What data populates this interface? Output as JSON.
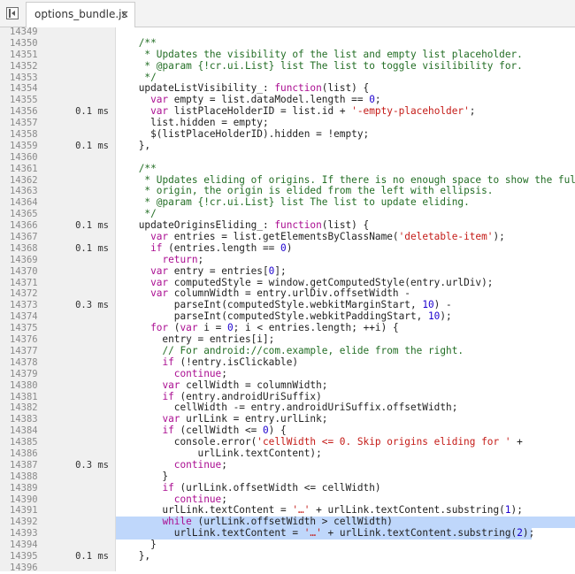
{
  "tab": {
    "filename": "options_bundle.js",
    "close_glyph": "×"
  },
  "lines": [
    {
      "num": "14349",
      "time": "",
      "segs": []
    },
    {
      "num": "14350",
      "time": "",
      "segs": [
        {
          "t": "    "
        },
        {
          "t": "/**",
          "c": "c"
        }
      ]
    },
    {
      "num": "14351",
      "time": "",
      "segs": [
        {
          "t": "     "
        },
        {
          "t": "* Updates the visibility of the list and empty list placeholder.",
          "c": "c"
        }
      ]
    },
    {
      "num": "14352",
      "time": "",
      "segs": [
        {
          "t": "     "
        },
        {
          "t": "* @param {!cr.ui.List} list The list to toggle visilibility for.",
          "c": "c"
        }
      ]
    },
    {
      "num": "14353",
      "time": "",
      "segs": [
        {
          "t": "     "
        },
        {
          "t": "*/",
          "c": "c"
        }
      ]
    },
    {
      "num": "14354",
      "time": "",
      "segs": [
        {
          "t": "    updateListVisibility_: "
        },
        {
          "t": "function",
          "c": "k"
        },
        {
          "t": "(list) {"
        }
      ]
    },
    {
      "num": "14355",
      "time": "",
      "segs": [
        {
          "t": "      "
        },
        {
          "t": "var",
          "c": "k"
        },
        {
          "t": " empty = list.dataModel.length == "
        },
        {
          "t": "0",
          "c": "n"
        },
        {
          "t": ";"
        }
      ]
    },
    {
      "num": "14356",
      "time": "0.1 ms",
      "segs": [
        {
          "t": "      "
        },
        {
          "t": "var",
          "c": "k"
        },
        {
          "t": " listPlaceHolderID = list.id + "
        },
        {
          "t": "'-empty-placeholder'",
          "c": "s"
        },
        {
          "t": ";"
        }
      ]
    },
    {
      "num": "14357",
      "time": "",
      "segs": [
        {
          "t": "      list.hidden = empty;"
        }
      ]
    },
    {
      "num": "14358",
      "time": "",
      "segs": [
        {
          "t": "      $(listPlaceHolderID).hidden = !empty;"
        }
      ]
    },
    {
      "num": "14359",
      "time": "0.1 ms",
      "segs": [
        {
          "t": "    },"
        }
      ]
    },
    {
      "num": "14360",
      "time": "",
      "segs": []
    },
    {
      "num": "14361",
      "time": "",
      "segs": [
        {
          "t": "    "
        },
        {
          "t": "/**",
          "c": "c"
        }
      ]
    },
    {
      "num": "14362",
      "time": "",
      "segs": [
        {
          "t": "     "
        },
        {
          "t": "* Updates eliding of origins. If there is no enough space to show the full",
          "c": "c"
        }
      ]
    },
    {
      "num": "14363",
      "time": "",
      "segs": [
        {
          "t": "     "
        },
        {
          "t": "* origin, the origin is elided from the left with ellipsis.",
          "c": "c"
        }
      ]
    },
    {
      "num": "14364",
      "time": "",
      "segs": [
        {
          "t": "     "
        },
        {
          "t": "* @param {!cr.ui.List} list The list to update eliding.",
          "c": "c"
        }
      ]
    },
    {
      "num": "14365",
      "time": "",
      "segs": [
        {
          "t": "     "
        },
        {
          "t": "*/",
          "c": "c"
        }
      ]
    },
    {
      "num": "14366",
      "time": "0.1 ms",
      "segs": [
        {
          "t": "    updateOriginsEliding_: "
        },
        {
          "t": "function",
          "c": "k"
        },
        {
          "t": "(list) {"
        }
      ]
    },
    {
      "num": "14367",
      "time": "",
      "segs": [
        {
          "t": "      "
        },
        {
          "t": "var",
          "c": "k"
        },
        {
          "t": " entries = list.getElementsByClassName("
        },
        {
          "t": "'deletable-item'",
          "c": "s"
        },
        {
          "t": ");"
        }
      ]
    },
    {
      "num": "14368",
      "time": "0.1 ms",
      "segs": [
        {
          "t": "      "
        },
        {
          "t": "if",
          "c": "k"
        },
        {
          "t": " (entries.length == "
        },
        {
          "t": "0",
          "c": "n"
        },
        {
          "t": ")"
        }
      ]
    },
    {
      "num": "14369",
      "time": "",
      "segs": [
        {
          "t": "        "
        },
        {
          "t": "return",
          "c": "k"
        },
        {
          "t": ";"
        }
      ]
    },
    {
      "num": "14370",
      "time": "",
      "segs": [
        {
          "t": "      "
        },
        {
          "t": "var",
          "c": "k"
        },
        {
          "t": " entry = entries["
        },
        {
          "t": "0",
          "c": "n"
        },
        {
          "t": "];"
        }
      ]
    },
    {
      "num": "14371",
      "time": "",
      "segs": [
        {
          "t": "      "
        },
        {
          "t": "var",
          "c": "k"
        },
        {
          "t": " computedStyle = window.getComputedStyle(entry.urlDiv);"
        }
      ]
    },
    {
      "num": "14372",
      "time": "",
      "segs": [
        {
          "t": "      "
        },
        {
          "t": "var",
          "c": "k"
        },
        {
          "t": " columnWidth = entry.urlDiv.offsetWidth -"
        }
      ]
    },
    {
      "num": "14373",
      "time": "0.3 ms",
      "segs": [
        {
          "t": "          parseInt(computedStyle.webkitMarginStart, "
        },
        {
          "t": "10",
          "c": "n"
        },
        {
          "t": ") -"
        }
      ]
    },
    {
      "num": "14374",
      "time": "",
      "segs": [
        {
          "t": "          parseInt(computedStyle.webkitPaddingStart, "
        },
        {
          "t": "10",
          "c": "n"
        },
        {
          "t": ");"
        }
      ]
    },
    {
      "num": "14375",
      "time": "",
      "segs": [
        {
          "t": "      "
        },
        {
          "t": "for",
          "c": "k"
        },
        {
          "t": " ("
        },
        {
          "t": "var",
          "c": "k"
        },
        {
          "t": " i = "
        },
        {
          "t": "0",
          "c": "n"
        },
        {
          "t": "; i < entries.length; ++i) {"
        }
      ]
    },
    {
      "num": "14376",
      "time": "",
      "segs": [
        {
          "t": "        entry = entries[i];"
        }
      ]
    },
    {
      "num": "14377",
      "time": "",
      "segs": [
        {
          "t": "        "
        },
        {
          "t": "// For android://com.example, elide from the right.",
          "c": "c"
        }
      ]
    },
    {
      "num": "14378",
      "time": "",
      "segs": [
        {
          "t": "        "
        },
        {
          "t": "if",
          "c": "k"
        },
        {
          "t": " (!entry.isClickable)"
        }
      ]
    },
    {
      "num": "14379",
      "time": "",
      "segs": [
        {
          "t": "          "
        },
        {
          "t": "continue",
          "c": "k"
        },
        {
          "t": ";"
        }
      ]
    },
    {
      "num": "14380",
      "time": "",
      "segs": [
        {
          "t": "        "
        },
        {
          "t": "var",
          "c": "k"
        },
        {
          "t": " cellWidth = columnWidth;"
        }
      ]
    },
    {
      "num": "14381",
      "time": "",
      "segs": [
        {
          "t": "        "
        },
        {
          "t": "if",
          "c": "k"
        },
        {
          "t": " (entry.androidUriSuffix)"
        }
      ]
    },
    {
      "num": "14382",
      "time": "",
      "segs": [
        {
          "t": "          cellWidth -= entry.androidUriSuffix.offsetWidth;"
        }
      ]
    },
    {
      "num": "14383",
      "time": "",
      "segs": [
        {
          "t": "        "
        },
        {
          "t": "var",
          "c": "k"
        },
        {
          "t": " urlLink = entry.urlLink;"
        }
      ]
    },
    {
      "num": "14384",
      "time": "",
      "segs": [
        {
          "t": "        "
        },
        {
          "t": "if",
          "c": "k"
        },
        {
          "t": " (cellWidth <= "
        },
        {
          "t": "0",
          "c": "n"
        },
        {
          "t": ") {"
        }
      ]
    },
    {
      "num": "14385",
      "time": "",
      "segs": [
        {
          "t": "          console.error("
        },
        {
          "t": "'cellWidth <= 0. Skip origins eliding for '",
          "c": "s"
        },
        {
          "t": " +"
        }
      ]
    },
    {
      "num": "14386",
      "time": "",
      "segs": [
        {
          "t": "              urlLink.textContent);"
        }
      ]
    },
    {
      "num": "14387",
      "time": "0.3 ms",
      "segs": [
        {
          "t": "          "
        },
        {
          "t": "continue",
          "c": "k"
        },
        {
          "t": ";"
        }
      ]
    },
    {
      "num": "14388",
      "time": "",
      "segs": [
        {
          "t": "        }"
        }
      ]
    },
    {
      "num": "14389",
      "time": "",
      "segs": [
        {
          "t": "        "
        },
        {
          "t": "if",
          "c": "k"
        },
        {
          "t": " (urlLink.offsetWidth <= cellWidth)"
        }
      ]
    },
    {
      "num": "14390",
      "time": "",
      "segs": [
        {
          "t": "          "
        },
        {
          "t": "continue",
          "c": "k"
        },
        {
          "t": ";"
        }
      ]
    },
    {
      "num": "14391",
      "time": "",
      "segs": [
        {
          "t": "        urlLink.textContent = "
        },
        {
          "t": "'…'",
          "c": "s"
        },
        {
          "t": " + urlLink.textContent.substring("
        },
        {
          "t": "1",
          "c": "n"
        },
        {
          "t": ");"
        }
      ]
    },
    {
      "num": "14392",
      "time": "",
      "hl": "full",
      "segs": [
        {
          "t": "        "
        },
        {
          "t": "while",
          "c": "k"
        },
        {
          "t": " (urlLink.offsetWidth > cellWidth)"
        }
      ]
    },
    {
      "num": "14393",
      "time": "",
      "hl": "partial",
      "segs": [
        {
          "t": "          urlLink.textContent = "
        },
        {
          "t": "'…'",
          "c": "s"
        },
        {
          "t": " + urlLink.textContent.substring("
        },
        {
          "t": "2",
          "c": "n"
        },
        {
          "t": ");"
        }
      ]
    },
    {
      "num": "14394",
      "time": "",
      "segs": [
        {
          "t": "      }"
        }
      ]
    },
    {
      "num": "14395",
      "time": "0.1 ms",
      "segs": [
        {
          "t": "    },"
        }
      ]
    },
    {
      "num": "14396",
      "time": "",
      "segs": []
    }
  ]
}
